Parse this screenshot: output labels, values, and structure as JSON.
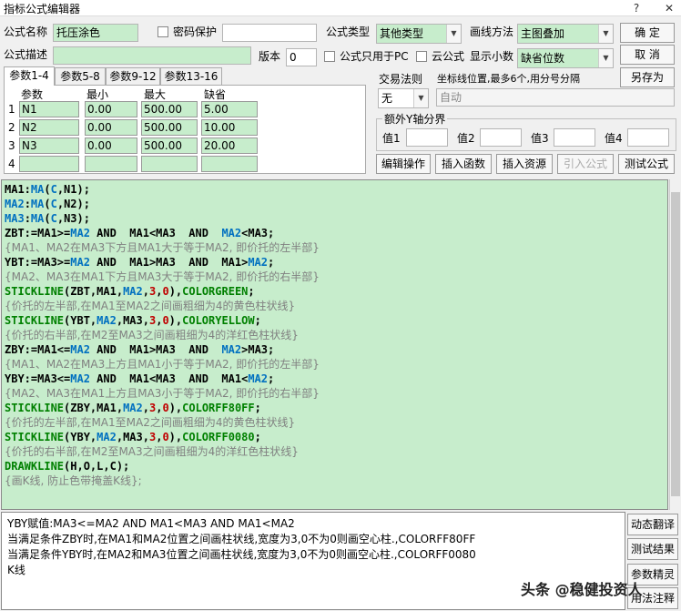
{
  "window": {
    "title": "指标公式编辑器",
    "help": "?",
    "close": "✕"
  },
  "form": {
    "name_label": "公式名称",
    "name_value": "托压涂色",
    "pwd_label": "密码保护",
    "pwd_value": "",
    "type_label": "公式类型",
    "type_value": "其他类型",
    "draw_label": "画线方法",
    "draw_value": "主图叠加",
    "desc_label": "公式描述",
    "desc_value": "",
    "version_label": "版本",
    "version_value": "0",
    "pc_only_label": "公式只用于PC",
    "cloud_label": "云公式",
    "decimal_label": "显示小数",
    "decimal_value": "缺省位数"
  },
  "buttons": {
    "ok": "确  定",
    "cancel": "取  消",
    "save_as": "另存为",
    "edit_op": "编辑操作",
    "insert_func": "插入函数",
    "insert_res": "插入资源",
    "import": "引入公式",
    "test": "测试公式"
  },
  "tabs": [
    "参数1-4",
    "参数5-8",
    "参数9-12",
    "参数13-16"
  ],
  "params": {
    "headers": [
      "参数",
      "最小",
      "最大",
      "缺省"
    ],
    "rows": [
      {
        "num": "1",
        "name": "N1",
        "min": "0.00",
        "max": "500.00",
        "def": "5.00"
      },
      {
        "num": "2",
        "name": "N2",
        "min": "0.00",
        "max": "500.00",
        "def": "10.00"
      },
      {
        "num": "3",
        "name": "N3",
        "min": "0.00",
        "max": "500.00",
        "def": "20.00"
      },
      {
        "num": "4",
        "name": "",
        "min": "",
        "max": "",
        "def": ""
      }
    ]
  },
  "trade": {
    "rule_label": "交易法则",
    "rule_value": "无",
    "coord_label": "坐标线位置,最多6个,用分号分隔",
    "coord_placeholder": "自动"
  },
  "yaxis": {
    "label": "额外Y轴分界",
    "v1": "值1",
    "v2": "值2",
    "v3": "值3",
    "v4": "值4"
  },
  "code_lines": [
    [
      [
        "kw",
        "MA1:"
      ],
      [
        "fn",
        "MA"
      ],
      [
        "kw",
        "("
      ],
      [
        "fn",
        "C"
      ],
      [
        "kw",
        ",N1);"
      ]
    ],
    [
      [
        "fn",
        "MA2"
      ],
      [
        "kw",
        ":"
      ],
      [
        "fn",
        "MA"
      ],
      [
        "kw",
        "("
      ],
      [
        "fn",
        "C"
      ],
      [
        "kw",
        ",N2);"
      ]
    ],
    [
      [
        "fn",
        "MA3"
      ],
      [
        "kw",
        ":"
      ],
      [
        "fn",
        "MA"
      ],
      [
        "kw",
        "("
      ],
      [
        "fn",
        "C"
      ],
      [
        "kw",
        ",N3);"
      ]
    ],
    [
      [
        "kw",
        "ZBT:=MA1>="
      ],
      [
        "fn",
        "MA2"
      ],
      [
        "kw",
        " AND  MA1<MA3  AND  "
      ],
      [
        "fn",
        "MA2"
      ],
      [
        "kw",
        "<MA3;"
      ]
    ],
    [
      [
        "cm",
        "{MA1、MA2在MA3下方且MA1大于等于MA2, 即价托的左半部}"
      ]
    ],
    [
      [
        "kw",
        "YBT:=MA3>="
      ],
      [
        "fn",
        "MA2"
      ],
      [
        "kw",
        " AND  MA1>MA3  AND  MA1>"
      ],
      [
        "fn",
        "MA2"
      ],
      [
        "kw",
        ";"
      ]
    ],
    [
      [
        "cm",
        "{MA2、MA3在MA1下方且MA3大于等于MA2, 即价托的右半部}"
      ]
    ],
    [
      [
        "sk",
        "STICKLINE"
      ],
      [
        "kw",
        "(ZBT,MA1,"
      ],
      [
        "fn",
        "MA2"
      ],
      [
        "kw",
        ","
      ],
      [
        "num",
        "3"
      ],
      [
        "kw",
        ","
      ],
      [
        "num",
        "0"
      ],
      [
        "kw",
        "),"
      ],
      [
        "sk",
        "COLORGREEN"
      ],
      [
        "kw",
        ";"
      ]
    ],
    [
      [
        "cm",
        "{价托的左半部,在MA1至MA2之间画粗细为4的黄色柱状线}"
      ]
    ],
    [
      [
        "sk",
        "STICKLINE"
      ],
      [
        "kw",
        "(YBT,"
      ],
      [
        "fn",
        "MA2"
      ],
      [
        "kw",
        ",MA3,"
      ],
      [
        "num",
        "3"
      ],
      [
        "kw",
        ","
      ],
      [
        "num",
        "0"
      ],
      [
        "kw",
        "),"
      ],
      [
        "sk",
        "COLORYELLOW"
      ],
      [
        "kw",
        ";"
      ]
    ],
    [
      [
        "cm",
        "{价托的右半部,在M2至MA3之间画粗细为4的洋红色柱状线}"
      ]
    ],
    [
      [
        "kw",
        "ZBY:=MA1<="
      ],
      [
        "fn",
        "MA2"
      ],
      [
        "kw",
        " AND  MA1>MA3  AND  "
      ],
      [
        "fn",
        "MA2"
      ],
      [
        "kw",
        ">MA3;"
      ]
    ],
    [
      [
        "cm",
        "{MA1、MA2在MA3上方且MA1小于等于MA2, 即价托的左半部}"
      ]
    ],
    [
      [
        "kw",
        "YBY:=MA3<="
      ],
      [
        "fn",
        "MA2"
      ],
      [
        "kw",
        " AND  MA1<MA3  AND  MA1<"
      ],
      [
        "fn",
        "MA2"
      ],
      [
        "kw",
        ";"
      ]
    ],
    [
      [
        "cm",
        "{MA2、MA3在MA1上方且MA3小于等于MA2, 即价托的右半部}"
      ]
    ],
    [
      [
        "sk",
        "STICKLINE"
      ],
      [
        "kw",
        "(ZBY,MA1,"
      ],
      [
        "fn",
        "MA2"
      ],
      [
        "kw",
        ","
      ],
      [
        "num",
        "3"
      ],
      [
        "kw",
        ","
      ],
      [
        "num",
        "0"
      ],
      [
        "kw",
        "),"
      ],
      [
        "sk",
        "COLORFF80FF"
      ],
      [
        "kw",
        ";"
      ]
    ],
    [
      [
        "cm",
        "{价托的左半部,在MA1至MA2之间画粗细为4的黄色柱状线}"
      ]
    ],
    [
      [
        "sk",
        "STICKLINE"
      ],
      [
        "kw",
        "(YBY,"
      ],
      [
        "fn",
        "MA2"
      ],
      [
        "kw",
        ",MA3,"
      ],
      [
        "num",
        "3"
      ],
      [
        "kw",
        ","
      ],
      [
        "num",
        "0"
      ],
      [
        "kw",
        "),"
      ],
      [
        "sk",
        "COLORFF0080"
      ],
      [
        "kw",
        ";"
      ]
    ],
    [
      [
        "cm",
        "{价托的右半部,在M2至MA3之间画粗细为4的洋红色柱状线}"
      ]
    ],
    [
      [
        "sk",
        "DRAWKLINE"
      ],
      [
        "kw",
        "(H,O,L,C);"
      ]
    ],
    [
      [
        "cm",
        "{画K线, 防止色带掩盖K线};"
      ]
    ]
  ],
  "output_lines": [
    "YBY赋值:MA3<=MA2 AND MA1<MA3 AND MA1<MA2",
    "当满足条件ZBY时,在MA1和MA2位置之间画柱状线,宽度为3,0不为0则画空心柱.,COLORFF80FF",
    "当满足条件YBY时,在MA2和MA3位置之间画柱状线,宽度为3,0不为0则画空心柱.,COLORFF0080",
    "K线"
  ],
  "side_buttons": [
    "动态翻译",
    "测试结果",
    "参数精灵",
    "用法注释"
  ],
  "watermark": "头条 @稳健投资人"
}
